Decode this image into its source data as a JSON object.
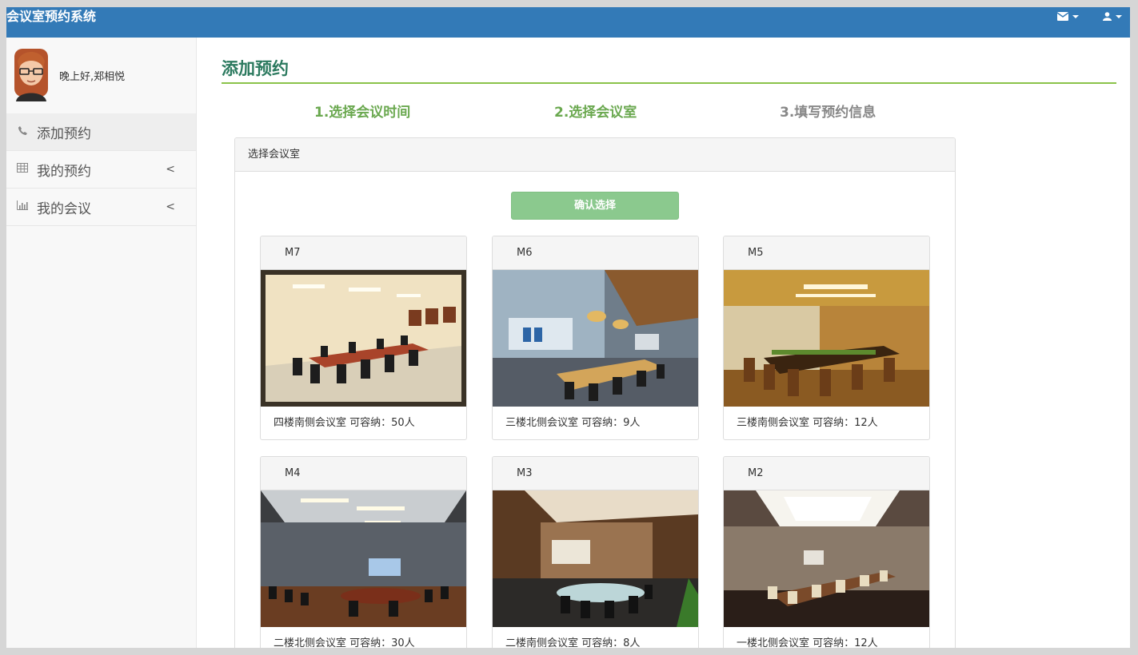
{
  "app": {
    "title": "会议室预约系统"
  },
  "topbar": {
    "mail_icon": "envelope-icon",
    "user_icon": "user-icon"
  },
  "sidebar": {
    "greeting": "晚上好,郑相悦",
    "items": [
      {
        "label": "添加预约",
        "icon": "phone-icon",
        "active": true
      },
      {
        "label": "我的预约",
        "icon": "table-icon",
        "arrow": "<"
      },
      {
        "label": "我的会议",
        "icon": "bar-chart-icon",
        "arrow": "<"
      }
    ]
  },
  "main": {
    "title": "添加预约",
    "steps": [
      {
        "label": "1.选择会议时间",
        "state": "done"
      },
      {
        "label": "2.选择会议室",
        "state": "done"
      },
      {
        "label": "3.填写预约信息",
        "state": "todo"
      }
    ],
    "panel": {
      "heading": "选择会议室",
      "confirm_label": "确认选择",
      "rooms": [
        {
          "name": "M7",
          "desc": "四楼南侧会议室 可容纳：50人"
        },
        {
          "name": "M6",
          "desc": "三楼北侧会议室 可容纳：9人"
        },
        {
          "name": "M5",
          "desc": "三楼南侧会议室 可容纳：12人"
        },
        {
          "name": "M4",
          "desc": "二楼北侧会议室 可容纳：30人"
        },
        {
          "name": "M3",
          "desc": "二楼南侧会议室 可容纳：8人"
        },
        {
          "name": "M2",
          "desc": "一楼北侧会议室 可容纳：12人"
        }
      ]
    }
  },
  "colors": {
    "topbar": "#337ab7",
    "accent_green": "#8bc34a",
    "step_done": "#6aa84f",
    "button": "#8bc98e"
  }
}
